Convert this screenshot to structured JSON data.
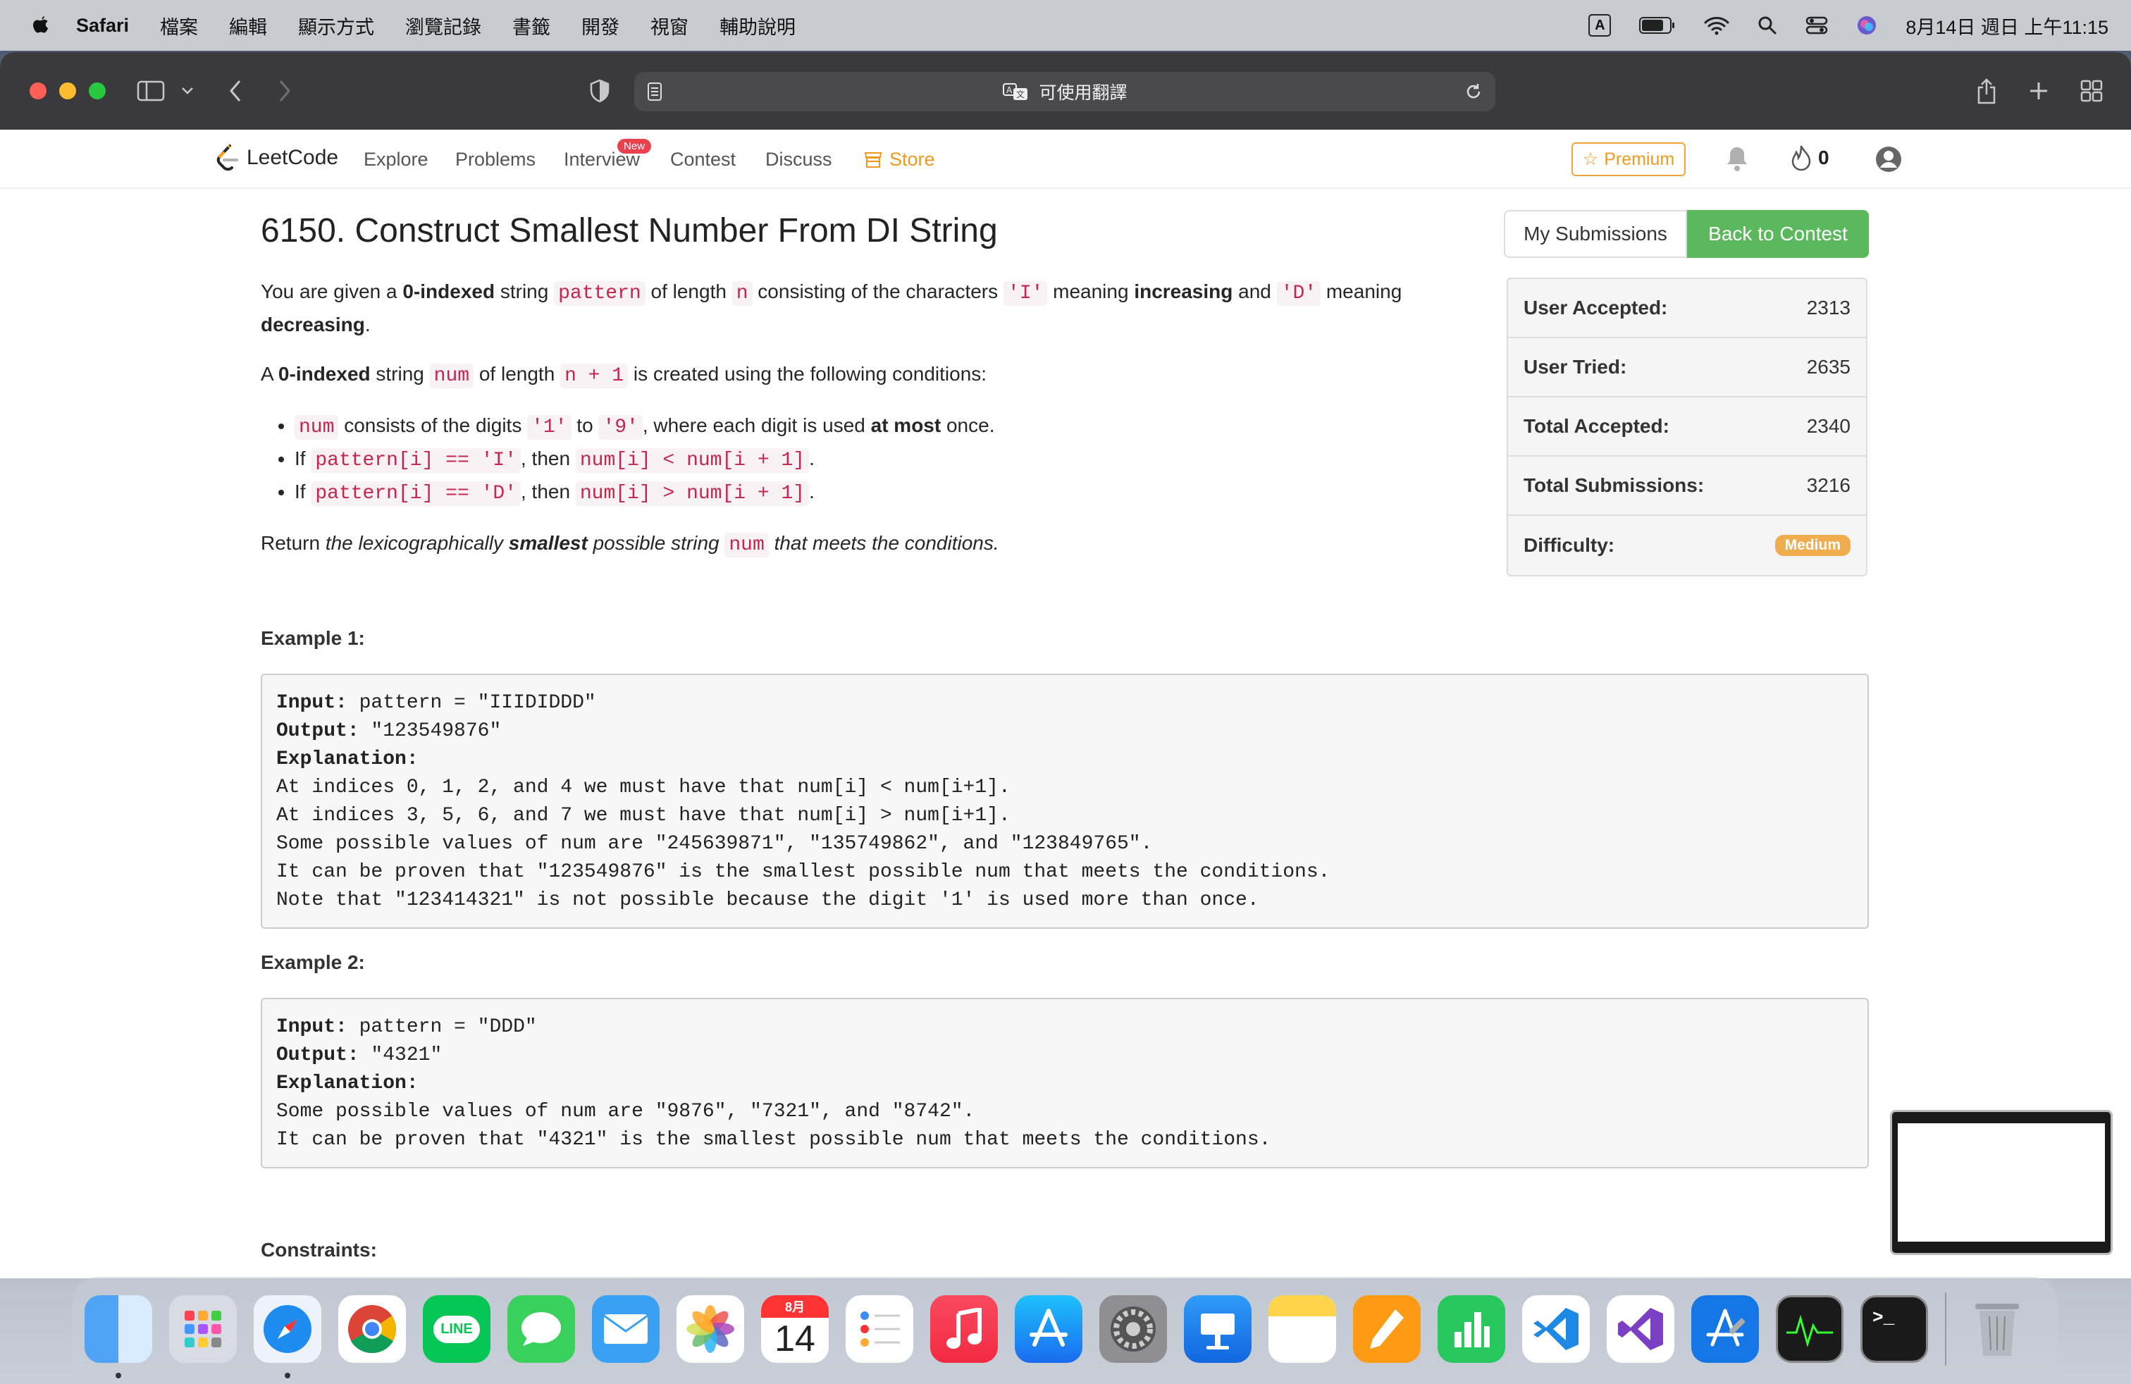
{
  "menubar": {
    "app_name": "Safari",
    "items": [
      "檔案",
      "編輯",
      "顯示方式",
      "瀏覽記錄",
      "書籤",
      "開發",
      "視窗",
      "輔助說明"
    ],
    "input_indicator": "A",
    "clock": "8月14日 週日 上午11:15"
  },
  "safari": {
    "url_text": "可使用翻譯"
  },
  "lc_nav": {
    "logo": "LeetCode",
    "items": [
      "Explore",
      "Problems",
      "Interview",
      "Contest",
      "Discuss",
      "Store"
    ],
    "new_badge": "New",
    "premium": "Premium",
    "streak_count": "0"
  },
  "problem": {
    "title": "6150. Construct Smallest Number From DI String",
    "desc1": {
      "t1": "You are given a ",
      "b1": "0-indexed",
      "t2": " string ",
      "c1": "pattern",
      "t3": " of length ",
      "c2": "n",
      "t4": " consisting of the characters ",
      "c3": "'I'",
      "t5": " meaning ",
      "b2": "increasing",
      "t6": " and ",
      "c4": "'D'",
      "t7": " meaning ",
      "b3": "decreasing",
      "t8": "."
    },
    "desc2": {
      "t1": "A ",
      "b1": "0-indexed",
      "t2": " string ",
      "c1": "num",
      "t3": " of length ",
      "c2": "n + 1",
      "t4": " is created using the following conditions:"
    },
    "bullets": [
      {
        "c1": "num",
        "t1": " consists of the digits ",
        "c2": "'1'",
        "t2": " to ",
        "c3": "'9'",
        "t3": ", where each digit is used ",
        "b1": "at most",
        "t4": " once."
      },
      {
        "t0": "If ",
        "c1": "pattern[i] == 'I'",
        "t1": ", then ",
        "c2": "num[i] < num[i + 1]",
        "t2": "."
      },
      {
        "t0": "If ",
        "c1": "pattern[i] == 'D'",
        "t1": ", then ",
        "c2": "num[i] > num[i + 1]",
        "t2": "."
      }
    ],
    "desc3": {
      "t1": "Return ",
      "i1": "the lexicographically ",
      "b1": "smallest",
      "i2": " possible string ",
      "c1": "num",
      "i3": " that meets the conditions."
    },
    "example1": {
      "title": "Example 1:",
      "input_label": "Input:",
      "input": " pattern = \"IIIDIDDD\"",
      "output_label": "Output:",
      "output": " \"123549876\"",
      "explanation_label": "Explanation:",
      "lines": [
        "At indices 0, 1, 2, and 4 we must have that num[i] < num[i+1].",
        "At indices 3, 5, 6, and 7 we must have that num[i] > num[i+1].",
        "Some possible values of num are \"245639871\", \"135749862\", and \"123849765\".",
        "It can be proven that \"123549876\" is the smallest possible num that meets the conditions.",
        "Note that \"123414321\" is not possible because the digit '1' is used more than once."
      ]
    },
    "example2": {
      "title": "Example 2:",
      "input_label": "Input:",
      "input": " pattern = \"DDD\"",
      "output_label": "Output:",
      "output": " \"4321\"",
      "explanation_label": "Explanation:",
      "lines": [
        "Some possible values of num are \"9876\", \"7321\", and \"8742\".",
        "It can be proven that \"4321\" is the smallest possible num that meets the conditions."
      ]
    },
    "constraints_title": "Constraints:"
  },
  "sidebar": {
    "my_submissions": "My Submissions",
    "back_to_contest": "Back to Contest",
    "stats": [
      {
        "label": "User Accepted:",
        "value": "2313"
      },
      {
        "label": "User Tried:",
        "value": "2635"
      },
      {
        "label": "Total Accepted:",
        "value": "2340"
      },
      {
        "label": "Total Submissions:",
        "value": "3216"
      }
    ],
    "difficulty_label": "Difficulty:",
    "difficulty_value": "Medium"
  },
  "dock": {
    "calendar_month": "8月",
    "calendar_day": "14",
    "apps": [
      "finder",
      "launchpad",
      "safari",
      "chrome",
      "line",
      "messages",
      "mail",
      "photos",
      "calendar",
      "reminders",
      "music",
      "app-store",
      "system-preferences",
      "keynote",
      "notes",
      "pages",
      "numbers",
      "vscode",
      "visual-studio",
      "xcode",
      "activity-monitor",
      "terminal",
      "trash"
    ],
    "line_label": "LINE"
  },
  "colors": {
    "accent_green": "#5cb85c",
    "store_orange": "#ef9a1f",
    "code_red": "#c7254e",
    "medium_badge": "#f0ad4e"
  }
}
